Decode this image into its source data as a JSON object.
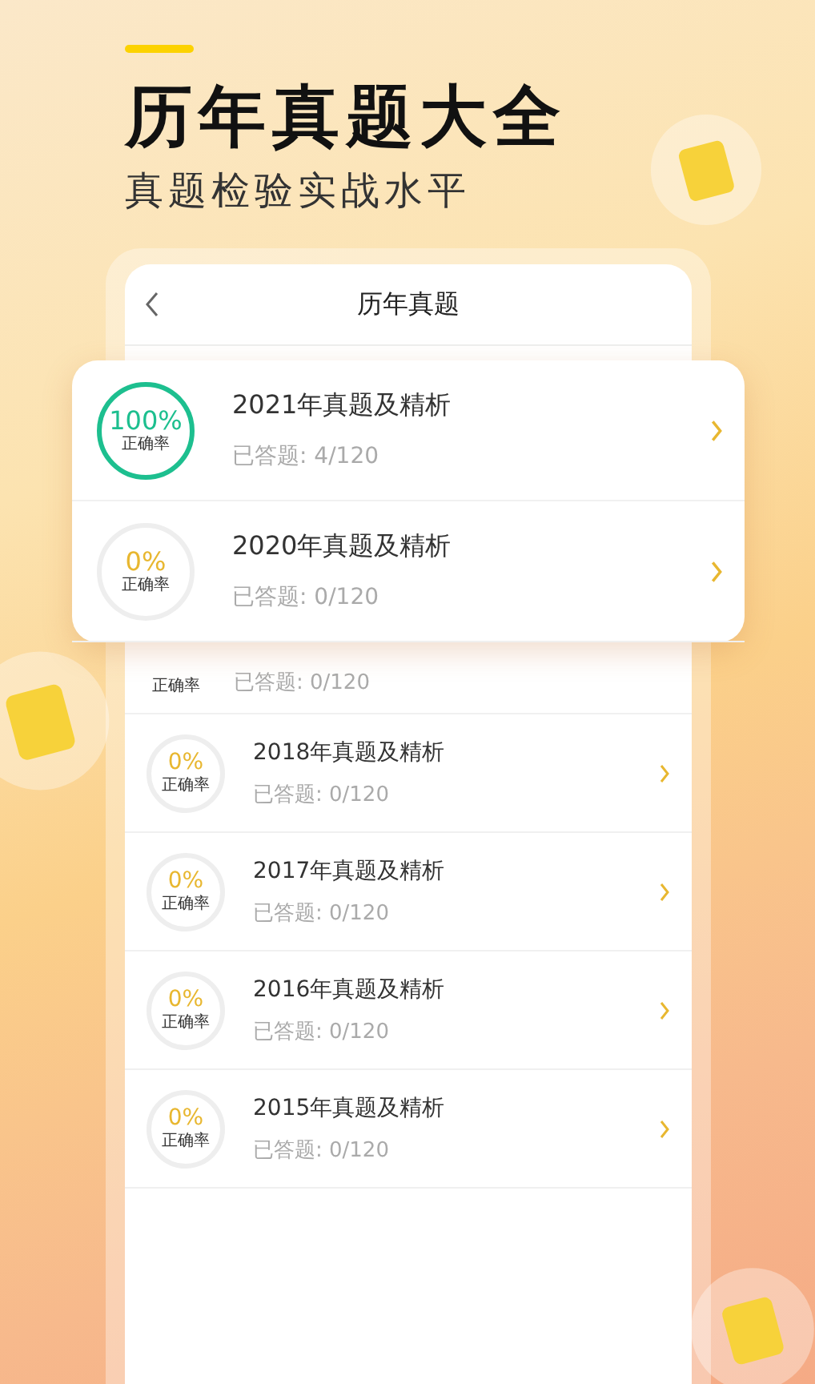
{
  "headline": {
    "title": "历年真题大全",
    "subtitle": "真题检验实战水平"
  },
  "phone": {
    "title": "历年真题",
    "partial_row": {
      "circle_label": "正确率",
      "answered": "已答题: 0/120"
    },
    "rows": [
      {
        "percent": "0%",
        "circle_label": "正确率",
        "completed": false,
        "title": "2018年真题及精析",
        "answered": "已答题: 0/120"
      },
      {
        "percent": "0%",
        "circle_label": "正确率",
        "completed": false,
        "title": "2017年真题及精析",
        "answered": "已答题: 0/120"
      },
      {
        "percent": "0%",
        "circle_label": "正确率",
        "completed": false,
        "title": "2016年真题及精析",
        "answered": "已答题: 0/120"
      },
      {
        "percent": "0%",
        "circle_label": "正确率",
        "completed": false,
        "title": "2015年真题及精析",
        "answered": "已答题: 0/120"
      }
    ]
  },
  "popup": {
    "rows": [
      {
        "percent": "100%",
        "circle_label": "正确率",
        "completed": true,
        "title": "2021年真题及精析",
        "answered": "已答题: 4/120"
      },
      {
        "percent": "0%",
        "circle_label": "正确率",
        "completed": false,
        "title": "2020年真题及精析",
        "answered": "已答题: 0/120"
      }
    ]
  }
}
